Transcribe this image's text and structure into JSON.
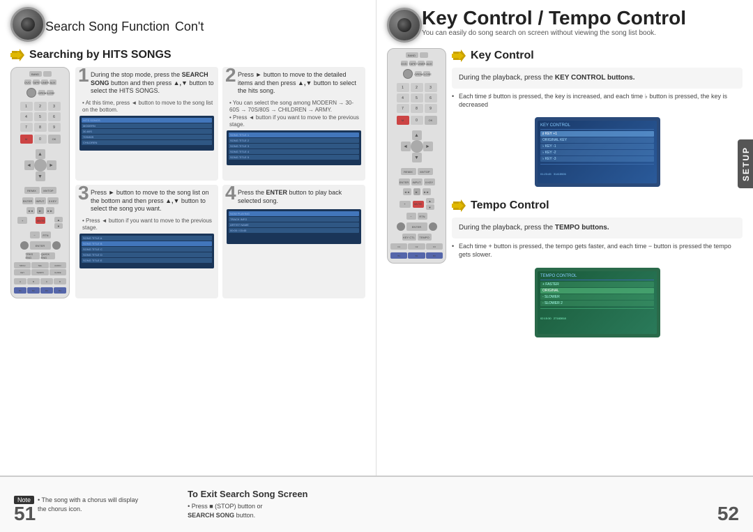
{
  "left": {
    "title": "Search Song Function",
    "title_cont": "Con't",
    "section_title": "Searching by HITS SONGS",
    "steps": [
      {
        "number": "1",
        "text": "During the stop mode, press the SEARCH SONG button and then press ▲,▼ button to select the HITS SONGS.",
        "bullet": "• At this time, press ◄ button to move to the song list on the bottom."
      },
      {
        "number": "2",
        "text": "Press ► button to move to the detailed items and then press ▲,▼ button to select the hits song.",
        "bullet": "• You can select the song among MODERN → 30-60S → 70S/80S → CHILDREN → ARMY.\n• Press ◄ button if you want to move to the previous stage."
      },
      {
        "number": "3",
        "text": "Press ► button to move to the song list on the bottom and then press ▲,▼ button to select the song you want.",
        "bullet": "• Press ◄ button if you want to move to the previous stage."
      },
      {
        "number": "4",
        "text": "Press the ENTER button to play back selected song.",
        "bullet": ""
      }
    ]
  },
  "right": {
    "title": "Key Control / Tempo Control",
    "subtitle": "You can easily do song search on screen without viewing the song list book.",
    "key_control": {
      "section_title": "Key Control",
      "info": "During the playback, press the KEY CONTROL buttons.",
      "bullet1": "Each time ♯ button is pressed, the key is increased, and each time ♭ button is pressed, the key is decreased"
    },
    "tempo_control": {
      "section_title": "Tempo Control",
      "info": "During the playback, press the TEMPO buttons.",
      "bullet1": "Each time + button is pressed, the tempo gets faster, and each time − button is pressed the tempo gets slower."
    }
  },
  "bottom": {
    "note_label": "Note",
    "note_text": "• The song with a chorus will display the chorus icon.",
    "exit_title": "To Exit Search Song Screen",
    "exit_bullet1": "• Press ■ (STOP) button or",
    "exit_bullet2_start": "SEARCH SONG",
    "exit_bullet2_end": " button."
  },
  "page_numbers": {
    "left": "51",
    "right": "52"
  },
  "setup_tab": "SETUP",
  "icons": {
    "arrow_bullet": "▶▶"
  }
}
